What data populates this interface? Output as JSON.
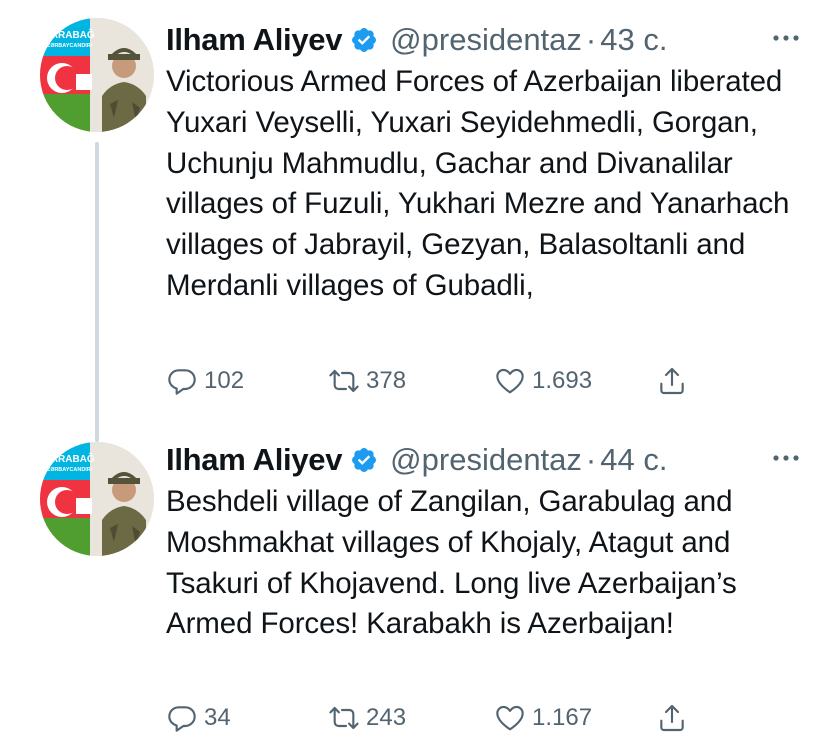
{
  "tweets": [
    {
      "author_name": "Ilham Aliyev",
      "handle": "@presidentaz",
      "separator": "·",
      "time": "43 с.",
      "text": "Victorious Armed Forces of Azerbaijan liberated Yuxari Veyselli, Yuxari Seyidehmedli, Gorgan, Uchunju Mahmudlu, Gachar and Divanalilar villages of Fuzuli, Yukhari Mezre and Yanarhach villages of Jabrayil, Gezyan, Balasoltanli and Merdanli villages of Gubadli,",
      "replies": "102",
      "retweets": "378",
      "likes": "1.693",
      "avatar_text_line1": "QARABAĞ",
      "avatar_text_line2": "AZƏRBAYCANDIR!"
    },
    {
      "author_name": "Ilham Aliyev",
      "handle": "@presidentaz",
      "separator": "·",
      "time": "44 с.",
      "text": "Beshdeli village of Zangilan, Garabulag and Moshmakhat villages of Khojaly, Atagut and Tsakuri of Khojavend. Long live Azerbaijan’s Armed Forces! Karabakh is Azerbaijan!",
      "replies": "34",
      "retweets": "243",
      "likes": "1.167",
      "avatar_text_line1": "QARABAĞ",
      "avatar_text_line2": "AZƏRBAYCANDIR!"
    }
  ],
  "colors": {
    "text": "#0f1419",
    "muted": "#536471",
    "verified": "#1d9bf0",
    "thread_line": "#cfd9de",
    "flag_blue": "#00b5e2",
    "flag_red": "#ef3340",
    "flag_green": "#509e2f"
  },
  "icons": [
    "verified-badge-icon",
    "more-options-icon",
    "reply-icon",
    "retweet-icon",
    "like-icon",
    "share-icon"
  ]
}
